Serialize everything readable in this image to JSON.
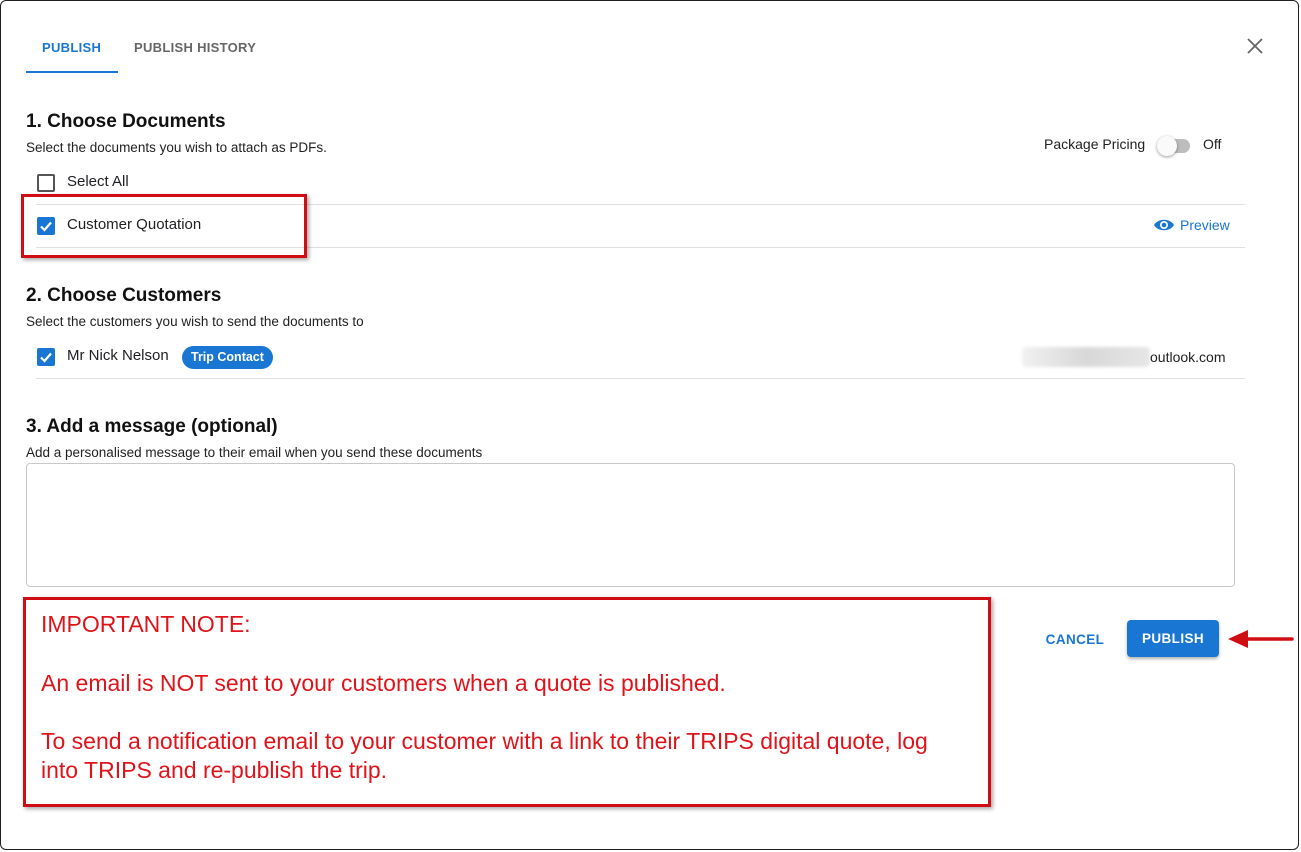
{
  "tabs": [
    {
      "label": "PUBLISH",
      "active": true
    },
    {
      "label": "PUBLISH HISTORY",
      "active": false
    }
  ],
  "section1": {
    "title": "1. Choose Documents",
    "subtitle": "Select the documents you wish to attach as PDFs.",
    "select_all_label": "Select All",
    "select_all_checked": false,
    "documents": [
      {
        "label": "Customer Quotation",
        "checked": true,
        "preview_label": "Preview"
      }
    ],
    "package_pricing_label": "Package Pricing",
    "package_pricing_state": "Off"
  },
  "section2": {
    "title": "2. Choose Customers",
    "subtitle": "Select the customers you wish to send the documents to",
    "customers": [
      {
        "name": "Mr Nick Nelson",
        "checked": true,
        "badge": "Trip Contact",
        "email_visible": "outlook.com"
      }
    ]
  },
  "section3": {
    "title": "3. Add a message (optional)",
    "subtitle": "Add a personalised message to their email when you send these documents",
    "message_value": ""
  },
  "note": {
    "heading": "IMPORTANT NOTE:",
    "line1": "An email is NOT sent to your customers when a quote is published.",
    "line2a": "To send a notification email to your customer with a link to their TRIPS digital quote, log",
    "line2b": "into TRIPS and re-publish the trip."
  },
  "actions": {
    "cancel_label": "CANCEL",
    "publish_label": "PUBLISH"
  },
  "colors": {
    "accent": "#1976d2",
    "annotation_red": "#e0131a"
  }
}
